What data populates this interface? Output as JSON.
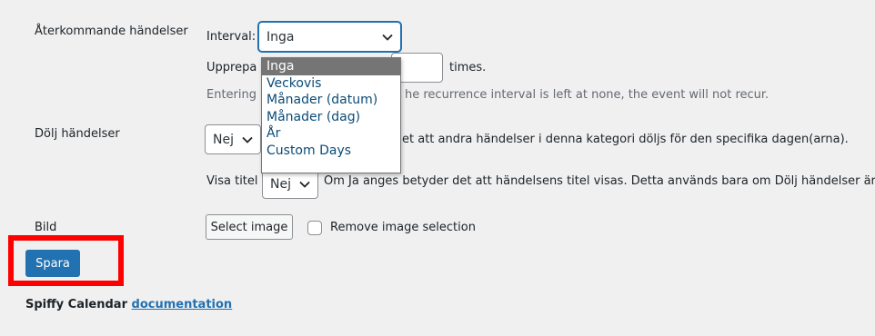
{
  "recurring": {
    "label": "Återkommande händelser",
    "interval_label": "Interval:",
    "interval_value": "Inga",
    "repeat_prefix": "Upprepa",
    "repeat_suffix": "times.",
    "help_prefix": "Entering",
    "help_suffix": "he recurrence interval is left at none, the event will not recur.",
    "options": [
      "Inga",
      "Veckovis",
      "Månader (datum)",
      "Månader (dag)",
      "År",
      "Custom Days"
    ],
    "selected_index": 0
  },
  "hide": {
    "label": "Dölj händelser",
    "value": "Nej",
    "help_suffix": "et att andra händelser i denna kategori döljs för den specifika dagen(arna).",
    "show_title_label": "Visa titel",
    "show_title_value": "Nej",
    "show_title_help": "Om Ja anges betyder det att händelsens titel visas. Detta används bara om Dölj händelser är sat"
  },
  "image": {
    "label": "Bild",
    "select_button": "Select image",
    "remove_label": "Remove image selection"
  },
  "actions": {
    "save_label": "Spara"
  },
  "footer": {
    "prefix": "Spiffy Calendar",
    "link": "documentation"
  },
  "colors": {
    "primary": "#2271b1",
    "highlight": "#ff0000",
    "background": "#f0f0f1",
    "selected_option_bg": "#757575"
  }
}
